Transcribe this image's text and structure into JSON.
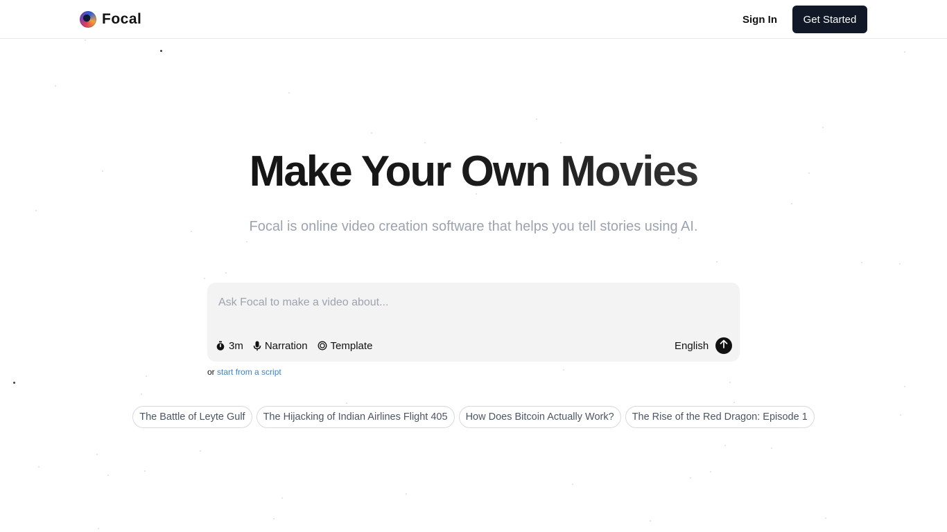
{
  "brand": {
    "name": "Focal"
  },
  "nav": {
    "signin_label": "Sign In",
    "cta_label": "Get Started"
  },
  "hero": {
    "title": "Make Your Own Movies",
    "subtitle": "Focal is online video creation software that helps you tell stories using AI."
  },
  "prompt": {
    "placeholder": "Ask Focal to make a video about...",
    "options": [
      {
        "icon": "stopwatch-icon",
        "label": "3m"
      },
      {
        "icon": "microphone-icon",
        "label": "Narration"
      },
      {
        "icon": "template-icon",
        "label": "Template"
      }
    ],
    "language": "English",
    "submit_icon": "arrow-up-icon"
  },
  "script_link": {
    "prefix": "or",
    "label": "start from a script"
  },
  "suggestions": [
    "The Battle of Leyte Gulf",
    "The Hijacking of Indian Airlines Flight 405",
    "How Does Bitcoin Actually Work?",
    "The Rise of the Red Dragon: Episode 1"
  ],
  "colors": {
    "cta_bg": "#111827",
    "subtitle": "#9ca3af",
    "link": "#3b82c4",
    "prompt_bg": "#f3f3f3"
  }
}
